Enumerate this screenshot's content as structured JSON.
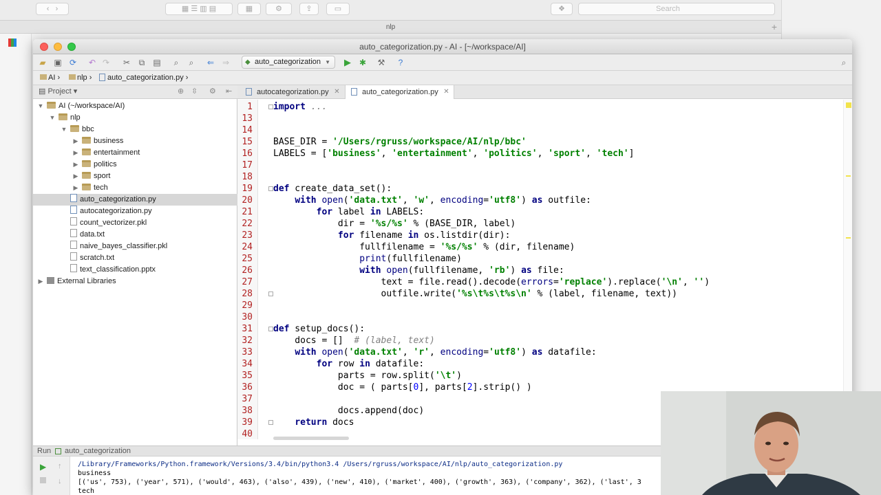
{
  "finder": {
    "title": "nlp",
    "search_placeholder": "Search"
  },
  "window": {
    "title": "auto_categorization.py - AI - [~/workspace/AI]"
  },
  "toolbar": {
    "run_config": "auto_categorization"
  },
  "navbar": {
    "crumbs": [
      "AI",
      "nlp",
      "auto_categorization.py"
    ]
  },
  "project": {
    "header": "Project",
    "tree": [
      {
        "label": "AI (~/workspace/AI)",
        "kind": "folder",
        "depth": 0,
        "expanded": true
      },
      {
        "label": "nlp",
        "kind": "folder",
        "depth": 1,
        "expanded": true
      },
      {
        "label": "bbc",
        "kind": "folder",
        "depth": 2,
        "expanded": true
      },
      {
        "label": "business",
        "kind": "folder",
        "depth": 3,
        "expanded": false
      },
      {
        "label": "entertainment",
        "kind": "folder",
        "depth": 3,
        "expanded": false
      },
      {
        "label": "politics",
        "kind": "folder",
        "depth": 3,
        "expanded": false
      },
      {
        "label": "sport",
        "kind": "folder",
        "depth": 3,
        "expanded": false
      },
      {
        "label": "tech",
        "kind": "folder",
        "depth": 3,
        "expanded": false
      },
      {
        "label": "auto_categorization.py",
        "kind": "py",
        "depth": 2,
        "selected": true
      },
      {
        "label": "autocategorization.py",
        "kind": "py",
        "depth": 2
      },
      {
        "label": "count_vectorizer.pkl",
        "kind": "txt",
        "depth": 2
      },
      {
        "label": "data.txt",
        "kind": "txt",
        "depth": 2
      },
      {
        "label": "naive_bayes_classifier.pkl",
        "kind": "txt",
        "depth": 2
      },
      {
        "label": "scratch.txt",
        "kind": "txt",
        "depth": 2
      },
      {
        "label": "text_classification.pptx",
        "kind": "txt",
        "depth": 2
      },
      {
        "label": "External Libraries",
        "kind": "lib",
        "depth": 0,
        "expanded": false
      }
    ]
  },
  "editor": {
    "tabs": [
      {
        "label": "autocategorization.py",
        "active": false
      },
      {
        "label": "auto_categorization.py",
        "active": true
      }
    ],
    "lines": [
      {
        "n": "1",
        "html": "<span class=\"kw\">import</span> <span class=\"cm\">...</span>"
      },
      {
        "n": "13",
        "html": ""
      },
      {
        "n": "14",
        "html": ""
      },
      {
        "n": "15",
        "html": "BASE_DIR = <span class=\"str\">'/Users/rgruss/workspace/AI/nlp/bbc'</span>"
      },
      {
        "n": "16",
        "html": "LABELS = [<span class=\"str\">'business'</span>, <span class=\"str\">'entertainment'</span>, <span class=\"str\">'politics'</span>, <span class=\"str\">'sport'</span>, <span class=\"str\">'tech'</span>]"
      },
      {
        "n": "17",
        "html": ""
      },
      {
        "n": "18",
        "html": ""
      },
      {
        "n": "19",
        "html": "<span class=\"kw\">def</span> create_data_set():"
      },
      {
        "n": "20",
        "html": "    <span class=\"kw\">with</span> <span class=\"bi\">open</span>(<span class=\"str\">'data.txt'</span>, <span class=\"str\">'w'</span>, <span class=\"bi\">encoding</span>=<span class=\"str\">'utf8'</span>) <span class=\"kw\">as</span> outfile:"
      },
      {
        "n": "21",
        "html": "        <span class=\"kw\">for</span> label <span class=\"kw\">in</span> LABELS:"
      },
      {
        "n": "22",
        "html": "            dir = <span class=\"str\">'%s/%s'</span> % (BASE_DIR, label)"
      },
      {
        "n": "23",
        "html": "            <span class=\"kw\">for</span> filename <span class=\"kw\">in</span> os.listdir(dir):"
      },
      {
        "n": "24",
        "html": "                fullfilename = <span class=\"str\">'%s/%s'</span> % (dir, filename)"
      },
      {
        "n": "25",
        "html": "                <span class=\"bi\">print</span>(fullfilename)"
      },
      {
        "n": "26",
        "html": "                <span class=\"kw\">with</span> <span class=\"bi\">open</span>(fullfilename, <span class=\"str\">'rb'</span>) <span class=\"kw\">as</span> file:"
      },
      {
        "n": "27",
        "html": "                    text = file.read().decode(<span class=\"bi\">errors</span>=<span class=\"str\">'replace'</span>).replace(<span class=\"str\">'\\n'</span>, <span class=\"str\">''</span>)"
      },
      {
        "n": "28",
        "html": "                    outfile.write(<span class=\"str\">'%s\\t%s\\t%s\\n'</span> % (label, filename, text))"
      },
      {
        "n": "29",
        "html": ""
      },
      {
        "n": "30",
        "html": ""
      },
      {
        "n": "31",
        "html": "<span class=\"kw\">def</span> setup_docs():"
      },
      {
        "n": "32",
        "html": "    docs = []  <span class=\"cm\"># (label, text)</span>"
      },
      {
        "n": "33",
        "html": "    <span class=\"kw\">with</span> <span class=\"bi\">open</span>(<span class=\"str\">'data.txt'</span>, <span class=\"str\">'r'</span>, <span class=\"bi\">encoding</span>=<span class=\"str\">'utf8'</span>) <span class=\"kw\">as</span> datafile:"
      },
      {
        "n": "34",
        "html": "        <span class=\"kw\">for</span> row <span class=\"kw\">in</span> datafile:"
      },
      {
        "n": "35",
        "html": "            parts = row.split(<span class=\"str\">'\\t'</span>)"
      },
      {
        "n": "36",
        "html": "            doc = ( parts[<span class=\"num\">0</span>], parts[<span class=\"num\">2</span>].strip() )"
      },
      {
        "n": "37",
        "html": ""
      },
      {
        "n": "38",
        "html": "            docs.append(doc)"
      },
      {
        "n": "39",
        "html": "    <span class=\"kw\">return</span> docs"
      },
      {
        "n": "40",
        "html": ""
      }
    ]
  },
  "run": {
    "label": "Run",
    "config": "auto_categorization",
    "output": [
      "/Library/Frameworks/Python.framework/Versions/3.4/bin/python3.4 /Users/rgruss/workspace/AI/nlp/auto_categorization.py",
      "business",
      "[('us', 753), ('year', 571), ('would', 463), ('also', 439), ('new', 410), ('market', 400), ('growth', 363), ('company', 362), ('last', 3",
      "tech"
    ]
  }
}
